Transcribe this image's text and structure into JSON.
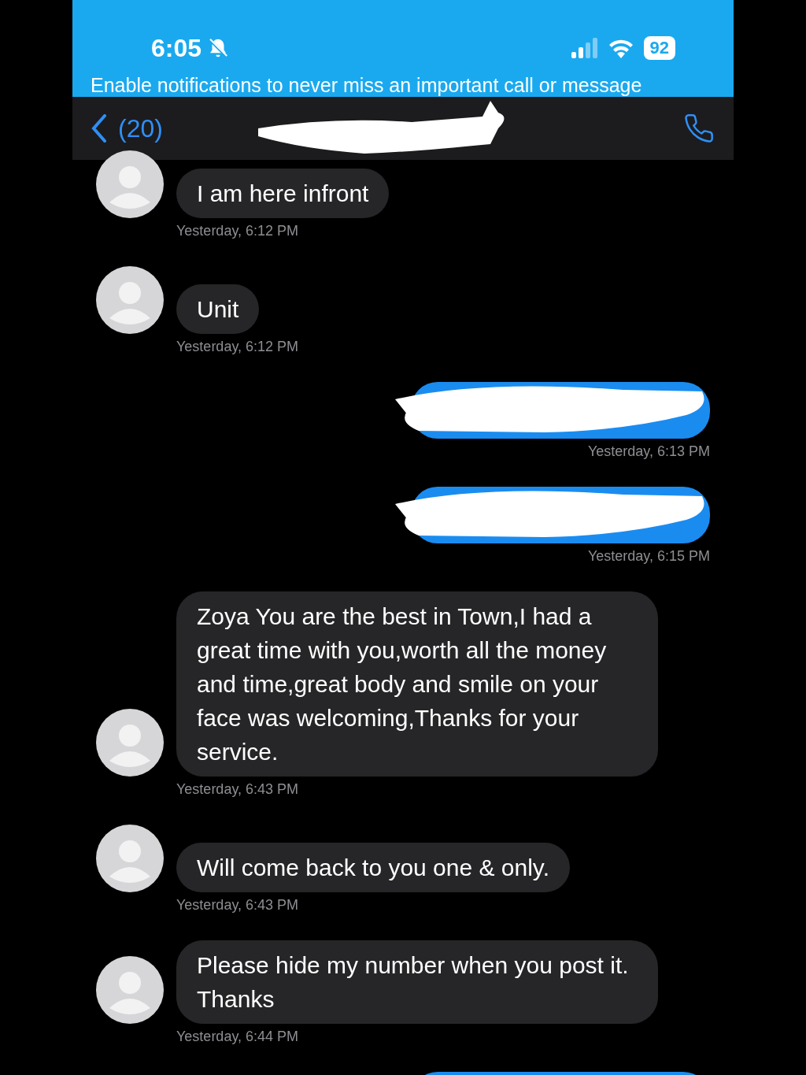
{
  "status_bar": {
    "time": "6:05",
    "battery": "92",
    "silent": true
  },
  "banner": {
    "text": "Enable notifications to never miss an important call or message"
  },
  "nav": {
    "back_label": "(20)",
    "contact_redacted": true
  },
  "messages": [
    {
      "kind": "received",
      "text": "I am here infront",
      "time": "Yesterday, 6:12 PM"
    },
    {
      "kind": "received",
      "text": "Unit",
      "time": "Yesterday, 6:12 PM"
    },
    {
      "kind": "sent",
      "redacted": true,
      "time": "Yesterday, 6:13 PM"
    },
    {
      "kind": "sent",
      "redacted": true,
      "time": "Yesterday, 6:15 PM"
    },
    {
      "kind": "received",
      "text": "Zoya You are the best in Town,I had a great time with you,worth all the money and time,great body and smile on your face was welcoming,Thanks for your service.",
      "time": "Yesterday, 6:43 PM"
    },
    {
      "kind": "received",
      "text": "Will come back to you one & only.",
      "time": "Yesterday, 6:43 PM"
    },
    {
      "kind": "received",
      "text": "Please hide my number when you post it. Thanks",
      "time": "Yesterday, 6:44 PM"
    },
    {
      "kind": "sent"
    }
  ]
}
